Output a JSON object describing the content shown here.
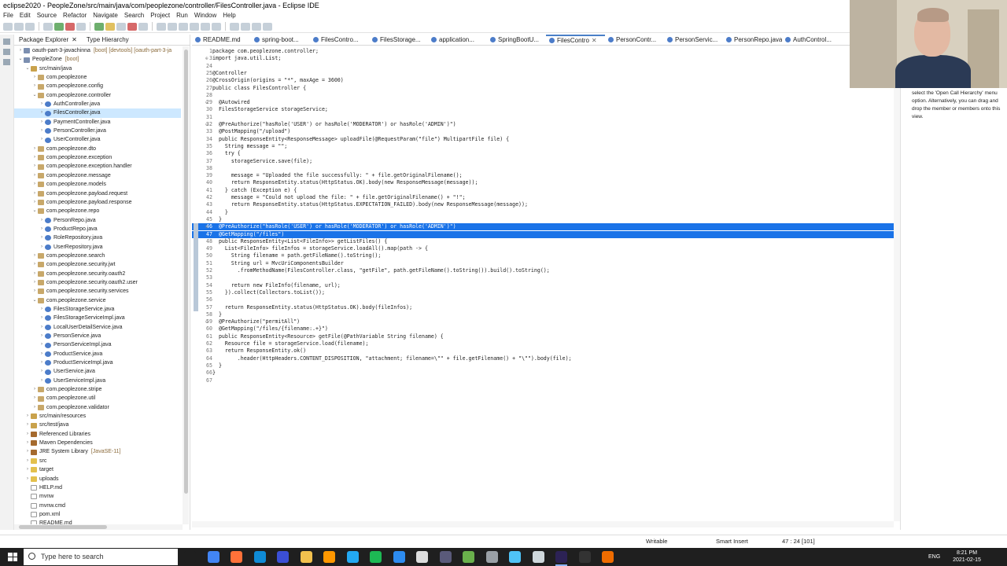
{
  "window": {
    "title": "eclipse2020 - PeopleZone/src/main/java/com/peoplezone/controller/FilesController.java - Eclipse IDE"
  },
  "menu": [
    "File",
    "Edit",
    "Source",
    "Refactor",
    "Navigate",
    "Search",
    "Project",
    "Run",
    "Window",
    "Help"
  ],
  "left_panel": {
    "tabs": [
      {
        "label": "Package Explorer",
        "active": true
      },
      {
        "label": "Type Hierarchy",
        "active": false
      }
    ],
    "tree": [
      {
        "level": 0,
        "twisty": "›",
        "icon": "proj",
        "label": "oauth-part-3-javachinna",
        "decoration": "[boot] [devtools] [oauth-part-3-ja"
      },
      {
        "level": 0,
        "twisty": "⌄",
        "icon": "proj",
        "label": "PeopleZone",
        "decoration": "[boot]"
      },
      {
        "level": 1,
        "twisty": "⌄",
        "icon": "src",
        "label": "src/main/java",
        "decoration": ""
      },
      {
        "level": 2,
        "twisty": "›",
        "icon": "pkg",
        "label": "com.peoplezone",
        "decoration": ""
      },
      {
        "level": 2,
        "twisty": "›",
        "icon": "pkg",
        "label": "com.peoplezone.config",
        "decoration": ""
      },
      {
        "level": 2,
        "twisty": "⌄",
        "icon": "pkg",
        "label": "com.peoplezone.controller",
        "decoration": ""
      },
      {
        "level": 3,
        "twisty": "›",
        "icon": "java",
        "label": "AuthController.java",
        "decoration": ""
      },
      {
        "level": 3,
        "twisty": "›",
        "icon": "java",
        "label": "FilesController.java",
        "decoration": "",
        "selected": true
      },
      {
        "level": 3,
        "twisty": "›",
        "icon": "java",
        "label": "PaymentController.java",
        "decoration": ""
      },
      {
        "level": 3,
        "twisty": "›",
        "icon": "java",
        "label": "PersonController.java",
        "decoration": ""
      },
      {
        "level": 3,
        "twisty": "›",
        "icon": "java",
        "label": "UserController.java",
        "decoration": ""
      },
      {
        "level": 2,
        "twisty": "›",
        "icon": "pkg",
        "label": "com.peoplezone.dto",
        "decoration": ""
      },
      {
        "level": 2,
        "twisty": "›",
        "icon": "pkg",
        "label": "com.peoplezone.exception",
        "decoration": ""
      },
      {
        "level": 2,
        "twisty": "›",
        "icon": "pkg",
        "label": "com.peoplezone.exception.handler",
        "decoration": ""
      },
      {
        "level": 2,
        "twisty": "›",
        "icon": "pkg",
        "label": "com.peoplezone.message",
        "decoration": ""
      },
      {
        "level": 2,
        "twisty": "›",
        "icon": "pkg",
        "label": "com.peoplezone.models",
        "decoration": ""
      },
      {
        "level": 2,
        "twisty": "›",
        "icon": "pkg",
        "label": "com.peoplezone.payload.request",
        "decoration": ""
      },
      {
        "level": 2,
        "twisty": "›",
        "icon": "pkg",
        "label": "com.peoplezone.payload.response",
        "decoration": ""
      },
      {
        "level": 2,
        "twisty": "⌄",
        "icon": "pkg",
        "label": "com.peoplezone.repo",
        "decoration": ""
      },
      {
        "level": 3,
        "twisty": "›",
        "icon": "java",
        "label": "PersonRepo.java",
        "decoration": ""
      },
      {
        "level": 3,
        "twisty": "›",
        "icon": "java",
        "label": "ProductRepo.java",
        "decoration": ""
      },
      {
        "level": 3,
        "twisty": "›",
        "icon": "java",
        "label": "RoleRepository.java",
        "decoration": ""
      },
      {
        "level": 3,
        "twisty": "›",
        "icon": "java",
        "label": "UserRepository.java",
        "decoration": ""
      },
      {
        "level": 2,
        "twisty": "›",
        "icon": "pkg",
        "label": "com.peoplezone.search",
        "decoration": ""
      },
      {
        "level": 2,
        "twisty": "›",
        "icon": "pkg",
        "label": "com.peoplezone.security.jwt",
        "decoration": ""
      },
      {
        "level": 2,
        "twisty": "›",
        "icon": "pkg",
        "label": "com.peoplezone.security.oauth2",
        "decoration": ""
      },
      {
        "level": 2,
        "twisty": "›",
        "icon": "pkg",
        "label": "com.peoplezone.security.oauth2.user",
        "decoration": ""
      },
      {
        "level": 2,
        "twisty": "›",
        "icon": "pkg",
        "label": "com.peoplezone.security.services",
        "decoration": ""
      },
      {
        "level": 2,
        "twisty": "⌄",
        "icon": "pkg",
        "label": "com.peoplezone.service",
        "decoration": ""
      },
      {
        "level": 3,
        "twisty": "›",
        "icon": "java",
        "label": "FilesStorageService.java",
        "decoration": ""
      },
      {
        "level": 3,
        "twisty": "›",
        "icon": "java",
        "label": "FilesStorageServiceImpl.java",
        "decoration": ""
      },
      {
        "level": 3,
        "twisty": "›",
        "icon": "java",
        "label": "LocalUserDetailService.java",
        "decoration": ""
      },
      {
        "level": 3,
        "twisty": "›",
        "icon": "java",
        "label": "PersonService.java",
        "decoration": ""
      },
      {
        "level": 3,
        "twisty": "›",
        "icon": "java",
        "label": "PersonServiceImpl.java",
        "decoration": ""
      },
      {
        "level": 3,
        "twisty": "›",
        "icon": "java",
        "label": "ProductService.java",
        "decoration": ""
      },
      {
        "level": 3,
        "twisty": "›",
        "icon": "java",
        "label": "ProductServiceImpl.java",
        "decoration": ""
      },
      {
        "level": 3,
        "twisty": "›",
        "icon": "java",
        "label": "UserService.java",
        "decoration": ""
      },
      {
        "level": 3,
        "twisty": "›",
        "icon": "java",
        "label": "UserServiceImpl.java",
        "decoration": ""
      },
      {
        "level": 2,
        "twisty": "›",
        "icon": "pkg",
        "label": "com.peoplezone.stripe",
        "decoration": ""
      },
      {
        "level": 2,
        "twisty": "›",
        "icon": "pkg",
        "label": "com.peoplezone.util",
        "decoration": ""
      },
      {
        "level": 2,
        "twisty": "›",
        "icon": "pkg",
        "label": "com.peoplezone.validator",
        "decoration": ""
      },
      {
        "level": 1,
        "twisty": "›",
        "icon": "src",
        "label": "src/main/resources",
        "decoration": ""
      },
      {
        "level": 1,
        "twisty": "›",
        "icon": "src",
        "label": "src/test/java",
        "decoration": ""
      },
      {
        "level": 1,
        "twisty": "›",
        "icon": "lib",
        "label": "Referenced Libraries",
        "decoration": ""
      },
      {
        "level": 1,
        "twisty": "›",
        "icon": "lib",
        "label": "Maven Dependencies",
        "decoration": ""
      },
      {
        "level": 1,
        "twisty": "›",
        "icon": "lib",
        "label": "JRE System Library",
        "decoration": "[JavaSE-11]"
      },
      {
        "level": 1,
        "twisty": "›",
        "icon": "folder",
        "label": "src",
        "decoration": ""
      },
      {
        "level": 1,
        "twisty": "›",
        "icon": "folder",
        "label": "target",
        "decoration": ""
      },
      {
        "level": 1,
        "twisty": "›",
        "icon": "folder",
        "label": "uploads",
        "decoration": ""
      },
      {
        "level": 1,
        "twisty": "",
        "icon": "file",
        "label": "HELP.md",
        "decoration": ""
      },
      {
        "level": 1,
        "twisty": "",
        "icon": "file",
        "label": "mvnw",
        "decoration": ""
      },
      {
        "level": 1,
        "twisty": "",
        "icon": "file",
        "label": "mvnw.cmd",
        "decoration": ""
      },
      {
        "level": 1,
        "twisty": "",
        "icon": "file",
        "label": "pom.xml",
        "decoration": ""
      },
      {
        "level": 1,
        "twisty": "",
        "icon": "file",
        "label": "README.md",
        "decoration": ""
      }
    ]
  },
  "editor": {
    "tabs": [
      {
        "label": "README.md",
        "active": false
      },
      {
        "label": "spring-boot...",
        "active": false
      },
      {
        "label": "FilesContro...",
        "active": false
      },
      {
        "label": "FilesStorage...",
        "active": false
      },
      {
        "label": "application...",
        "active": false
      },
      {
        "label": "SpringBootU...",
        "active": false
      },
      {
        "label": "FilesContro",
        "active": true,
        "close": "✕"
      },
      {
        "label": "PersonContr...",
        "active": false
      },
      {
        "label": "PersonServic...",
        "active": false
      },
      {
        "label": "PersonRepo.java",
        "active": false
      },
      {
        "label": "AuthControl...",
        "active": false
      }
    ],
    "lines": [
      {
        "n": "1",
        "fold": "",
        "text": "package com.peoplezone.controller;"
      },
      {
        "n": "3",
        "fold": "⊕",
        "text": "import java.util.List;"
      },
      {
        "n": "24",
        "fold": "",
        "text": ""
      },
      {
        "n": "25",
        "fold": "",
        "text": "@Controller"
      },
      {
        "n": "26",
        "fold": "",
        "text": "@CrossOrigin(origins = \"*\", maxAge = 3600)"
      },
      {
        "n": "27",
        "fold": "",
        "text": "public class FilesController {"
      },
      {
        "n": "28",
        "fold": "",
        "text": ""
      },
      {
        "n": "29",
        "fold": "⊖",
        "text": "  @Autowired"
      },
      {
        "n": "30",
        "fold": "",
        "text": "  FilesStorageService storageService;"
      },
      {
        "n": "31",
        "fold": "",
        "text": ""
      },
      {
        "n": "32",
        "fold": "⊖",
        "text": "  @PreAuthorize(\"hasRole('USER') or hasRole('MODERATOR') or hasRole('ADMIN')\")"
      },
      {
        "n": "33",
        "fold": "",
        "text": "  @PostMapping(\"/upload\")"
      },
      {
        "n": "34",
        "fold": "",
        "text": "  public ResponseEntity<ResponseMessage> uploadFile(@RequestParam(\"file\") MultipartFile file) {"
      },
      {
        "n": "35",
        "fold": "",
        "text": "    String message = \"\";"
      },
      {
        "n": "36",
        "fold": "",
        "text": "    try {"
      },
      {
        "n": "37",
        "fold": "",
        "text": "      storageService.save(file);"
      },
      {
        "n": "38",
        "fold": "",
        "text": ""
      },
      {
        "n": "39",
        "fold": "",
        "text": "      message = \"Uploaded the file successfully: \" + file.getOriginalFilename();"
      },
      {
        "n": "40",
        "fold": "",
        "text": "      return ResponseEntity.status(HttpStatus.OK).body(new ResponseMessage(message));"
      },
      {
        "n": "41",
        "fold": "",
        "text": "    } catch (Exception e) {"
      },
      {
        "n": "42",
        "fold": "",
        "text": "      message = \"Could not upload the file: \" + file.getOriginalFilename() + \"!\";"
      },
      {
        "n": "43",
        "fold": "",
        "text": "      return ResponseEntity.status(HttpStatus.EXPECTATION_FAILED).body(new ResponseMessage(message));"
      },
      {
        "n": "44",
        "fold": "",
        "text": "    }"
      },
      {
        "n": "45",
        "fold": "",
        "text": "  }"
      },
      {
        "n": "46",
        "fold": "⊖",
        "text": "  @PreAuthorize(\"hasRole('USER') or hasRole('MODERATOR') or hasRole('ADMIN')\")",
        "selected": true
      },
      {
        "n": "47",
        "fold": "",
        "text": "  @GetMapping(\"/files\")",
        "selected": true
      },
      {
        "n": "48",
        "fold": "",
        "text": "  public ResponseEntity<List<FileInfo>> getListFiles() {"
      },
      {
        "n": "49",
        "fold": "",
        "text": "    List<FileInfo> fileInfos = storageService.loadAll().map(path -> {"
      },
      {
        "n": "50",
        "fold": "",
        "text": "      String filename = path.getFileName().toString();"
      },
      {
        "n": "51",
        "fold": "",
        "text": "      String url = MvcUriComponentsBuilder"
      },
      {
        "n": "52",
        "fold": "",
        "text": "        .fromMethodName(FilesController.class, \"getFile\", path.getFileName().toString()).build().toString();"
      },
      {
        "n": "53",
        "fold": "",
        "text": ""
      },
      {
        "n": "54",
        "fold": "",
        "text": "      return new FileInfo(filename, url);"
      },
      {
        "n": "55",
        "fold": "",
        "text": "    }).collect(Collectors.toList());"
      },
      {
        "n": "56",
        "fold": "",
        "text": ""
      },
      {
        "n": "57",
        "fold": "",
        "text": "    return ResponseEntity.status(HttpStatus.OK).body(fileInfos);"
      },
      {
        "n": "58",
        "fold": "",
        "text": "  }"
      },
      {
        "n": "59",
        "fold": "⊖",
        "text": "  @PreAuthorize(\"permitAll\")"
      },
      {
        "n": "60",
        "fold": "",
        "text": "  @GetMapping(\"/files/{filename:.+}\")"
      },
      {
        "n": "61",
        "fold": "",
        "text": "  public ResponseEntity<Resource> getFile(@PathVariable String filename) {"
      },
      {
        "n": "62",
        "fold": "",
        "text": "    Resource file = storageService.load(filename);"
      },
      {
        "n": "63",
        "fold": "",
        "text": "    return ResponseEntity.ok()"
      },
      {
        "n": "64",
        "fold": "",
        "text": "        .header(HttpHeaders.CONTENT_DISPOSITION, \"attachment; filename=\\\"\" + file.getFilename() + \"\\\"\").body(file);"
      },
      {
        "n": "65",
        "fold": "",
        "text": "  }"
      },
      {
        "n": "66",
        "fold": "",
        "text": "}"
      },
      {
        "n": "67",
        "fold": "",
        "text": ""
      }
    ]
  },
  "right_panel": {
    "hint": "select the 'Open Call Hierarchy' menu option. Alternatively, you can drag and drop the member or members onto this view."
  },
  "status_bar": {
    "mode": "Writable",
    "insert": "Smart Insert",
    "position": "47 : 24 [101]"
  },
  "taskbar": {
    "search_placeholder": "Type here to search",
    "apps": [
      {
        "name": "task-view-icon",
        "color": "#1f1f1f"
      },
      {
        "name": "chrome-icon",
        "color": "#4285f4"
      },
      {
        "name": "firefox-icon",
        "color": "#ff7139"
      },
      {
        "name": "edge-icon",
        "color": "#0f8bd6"
      },
      {
        "name": "m-app-icon",
        "color": "#3b4fd6"
      },
      {
        "name": "file-explorer-icon",
        "color": "#f2c14e"
      },
      {
        "name": "sublime-icon",
        "color": "#ff9800"
      },
      {
        "name": "vscode-icon",
        "color": "#23a9f2"
      },
      {
        "name": "spotify-icon",
        "color": "#1db954"
      },
      {
        "name": "app-blue-icon",
        "color": "#2d8cf0"
      },
      {
        "name": "app-clock-icon",
        "color": "#dddddd"
      },
      {
        "name": "app-dark-icon",
        "color": "#5a5a7a"
      },
      {
        "name": "app-green-icon",
        "color": "#6ab04c"
      },
      {
        "name": "app-gray-icon",
        "color": "#9aa0a6"
      },
      {
        "name": "app-cyan-icon",
        "color": "#4fc3f7"
      },
      {
        "name": "app-settings-icon",
        "color": "#cfd8dc"
      },
      {
        "name": "eclipse-icon",
        "color": "#2c2255"
      },
      {
        "name": "terminal-icon",
        "color": "#333333"
      },
      {
        "name": "app-orange-icon",
        "color": "#ef6c00"
      }
    ],
    "language": "ENG",
    "time": "8:21 PM",
    "date": "2021-02-15"
  }
}
